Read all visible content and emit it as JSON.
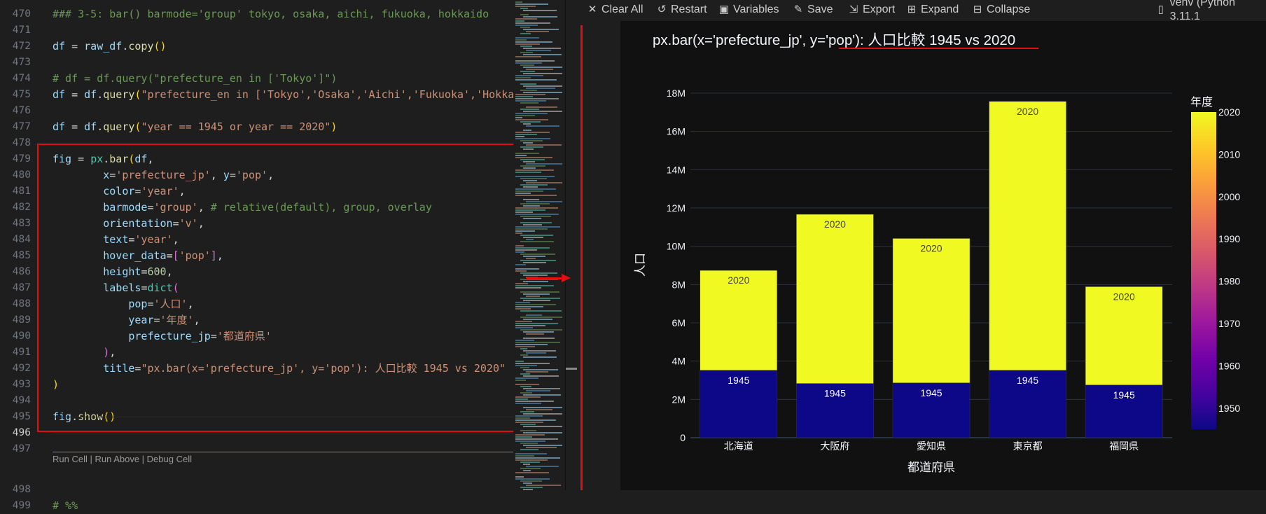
{
  "editor": {
    "lines": [
      {
        "n": "470",
        "tokens": [
          [
            "cm",
            "### 3-5: bar() barmode='group' tokyo, osaka, aichi, fukuoka, hokkaido"
          ]
        ]
      },
      {
        "n": "471",
        "tokens": []
      },
      {
        "n": "472",
        "tokens": [
          [
            "vr",
            "df"
          ],
          [
            "op",
            " = "
          ],
          [
            "vr",
            "raw_df"
          ],
          [
            "op",
            "."
          ],
          [
            "fn",
            "copy"
          ],
          [
            "py",
            "()"
          ]
        ]
      },
      {
        "n": "473",
        "tokens": []
      },
      {
        "n": "474",
        "tokens": [
          [
            "cm",
            "# df = df.query(\"prefecture_en in ['Tokyo']\")"
          ]
        ]
      },
      {
        "n": "475",
        "tokens": [
          [
            "vr",
            "df"
          ],
          [
            "op",
            " = "
          ],
          [
            "vr",
            "df"
          ],
          [
            "op",
            "."
          ],
          [
            "fn",
            "query"
          ],
          [
            "py",
            "("
          ],
          [
            "st",
            "\"prefecture_en in ['Tokyo','Osaka','Aichi','Fukuoka','Hokkaido']\""
          ],
          [
            "py",
            ")"
          ]
        ]
      },
      {
        "n": "476",
        "tokens": []
      },
      {
        "n": "477",
        "tokens": [
          [
            "vr",
            "df"
          ],
          [
            "op",
            " = "
          ],
          [
            "vr",
            "df"
          ],
          [
            "op",
            "."
          ],
          [
            "fn",
            "query"
          ],
          [
            "py",
            "("
          ],
          [
            "st",
            "\"year == 1945 or year == 2020\""
          ],
          [
            "py",
            ")"
          ]
        ]
      },
      {
        "n": "478",
        "tokens": []
      },
      {
        "n": "479",
        "tokens": [
          [
            "vr",
            "fig"
          ],
          [
            "op",
            " = "
          ],
          [
            "bi",
            "px"
          ],
          [
            "op",
            "."
          ],
          [
            "fn",
            "bar"
          ],
          [
            "py",
            "("
          ],
          [
            "vr",
            "df"
          ],
          [
            "op",
            ","
          ]
        ]
      },
      {
        "n": "480",
        "tokens": [
          [
            "op",
            "        "
          ],
          [
            "vr",
            "x"
          ],
          [
            "op",
            "="
          ],
          [
            "st",
            "'prefecture_jp'"
          ],
          [
            "op",
            ", "
          ],
          [
            "vr",
            "y"
          ],
          [
            "op",
            "="
          ],
          [
            "st",
            "'pop'"
          ],
          [
            "op",
            ","
          ]
        ]
      },
      {
        "n": "481",
        "tokens": [
          [
            "op",
            "        "
          ],
          [
            "vr",
            "color"
          ],
          [
            "op",
            "="
          ],
          [
            "st",
            "'year'"
          ],
          [
            "op",
            ","
          ]
        ]
      },
      {
        "n": "482",
        "tokens": [
          [
            "op",
            "        "
          ],
          [
            "vr",
            "barmode"
          ],
          [
            "op",
            "="
          ],
          [
            "st",
            "'group'"
          ],
          [
            "op",
            ", "
          ],
          [
            "cm",
            "# relative(default), group, overlay"
          ]
        ]
      },
      {
        "n": "483",
        "tokens": [
          [
            "op",
            "        "
          ],
          [
            "vr",
            "orientation"
          ],
          [
            "op",
            "="
          ],
          [
            "st",
            "'v'"
          ],
          [
            "op",
            ","
          ]
        ]
      },
      {
        "n": "484",
        "tokens": [
          [
            "op",
            "        "
          ],
          [
            "vr",
            "text"
          ],
          [
            "op",
            "="
          ],
          [
            "st",
            "'year'"
          ],
          [
            "op",
            ","
          ]
        ]
      },
      {
        "n": "485",
        "tokens": [
          [
            "op",
            "        "
          ],
          [
            "vr",
            "hover_data"
          ],
          [
            "op",
            "="
          ],
          [
            "pp",
            "["
          ],
          [
            "st",
            "'pop'"
          ],
          [
            "pp",
            "]"
          ],
          [
            "op",
            ","
          ]
        ]
      },
      {
        "n": "486",
        "tokens": [
          [
            "op",
            "        "
          ],
          [
            "vr",
            "height"
          ],
          [
            "op",
            "="
          ],
          [
            "nm",
            "600"
          ],
          [
            "op",
            ","
          ]
        ]
      },
      {
        "n": "487",
        "tokens": [
          [
            "op",
            "        "
          ],
          [
            "vr",
            "labels"
          ],
          [
            "op",
            "="
          ],
          [
            "bi",
            "dict"
          ],
          [
            "pp",
            "("
          ]
        ]
      },
      {
        "n": "488",
        "tokens": [
          [
            "op",
            "            "
          ],
          [
            "vr",
            "pop"
          ],
          [
            "op",
            "="
          ],
          [
            "st",
            "'人口'"
          ],
          [
            "op",
            ","
          ]
        ]
      },
      {
        "n": "489",
        "tokens": [
          [
            "op",
            "            "
          ],
          [
            "vr",
            "year"
          ],
          [
            "op",
            "="
          ],
          [
            "st",
            "'年度'"
          ],
          [
            "op",
            ","
          ]
        ]
      },
      {
        "n": "490",
        "tokens": [
          [
            "op",
            "            "
          ],
          [
            "vr",
            "prefecture_jp"
          ],
          [
            "op",
            "="
          ],
          [
            "st",
            "'都道府県'"
          ]
        ]
      },
      {
        "n": "491",
        "tokens": [
          [
            "op",
            "        "
          ],
          [
            "pp",
            ")"
          ],
          [
            "op",
            ","
          ]
        ]
      },
      {
        "n": "492",
        "tokens": [
          [
            "op",
            "        "
          ],
          [
            "vr",
            "title"
          ],
          [
            "op",
            "="
          ],
          [
            "st",
            "\"px.bar(x='prefecture_jp', y='pop'): 人口比較 1945 vs 2020\""
          ]
        ]
      },
      {
        "n": "493",
        "tokens": [
          [
            "py",
            ")"
          ]
        ]
      },
      {
        "n": "494",
        "tokens": []
      },
      {
        "n": "495",
        "tokens": [
          [
            "vr",
            "fig"
          ],
          [
            "op",
            "."
          ],
          [
            "fn",
            "show"
          ],
          [
            "py",
            "()"
          ]
        ]
      },
      {
        "n": "496",
        "tokens": [],
        "active": true
      },
      {
        "n": "497",
        "tokens": []
      }
    ],
    "codelens": "Run Cell | Run Above | Debug Cell",
    "line_498": {
      "n": "498",
      "text": "# %%"
    },
    "line_499": {
      "n": "499"
    }
  },
  "toolbar": {
    "items": [
      {
        "id": "clear-all",
        "label": "Clear All",
        "icon": "close-icon",
        "glyph": "✕"
      },
      {
        "id": "restart",
        "label": "Restart",
        "icon": "restart-icon",
        "glyph": "↺"
      },
      {
        "id": "variables",
        "label": "Variables",
        "icon": "variables-icon",
        "glyph": "▣"
      },
      {
        "id": "save",
        "label": "Save",
        "icon": "save-icon",
        "glyph": "✎"
      },
      {
        "id": "export",
        "label": "Export",
        "icon": "export-icon",
        "glyph": "⇲"
      },
      {
        "id": "expand",
        "label": "Expand",
        "icon": "expand-icon",
        "glyph": "⊞"
      },
      {
        "id": "collapse",
        "label": "Collapse",
        "icon": "collapse-icon",
        "glyph": "⊟"
      }
    ],
    "kernel": {
      "label": "venv (Python 3.11.1",
      "icon": "kernel-icon",
      "glyph": "▯"
    }
  },
  "chart_data": {
    "type": "bar",
    "barmode_rendered": "stacked",
    "title_prefix": "px.bar(x='prefecture_jp', y='pop'): ",
    "title_highlight": "人口比較 1945 vs 2020",
    "xlabel": "都道府県",
    "ylabel": "人口",
    "categories": [
      "北海道",
      "大阪府",
      "愛知県",
      "東京都",
      "福岡県"
    ],
    "series": [
      {
        "name": "1945",
        "color": "#0d0887",
        "text_color": "#ffffff",
        "values": [
          3520000,
          2830000,
          2860000,
          3520000,
          2750000
        ]
      },
      {
        "name": "2020",
        "color": "#f0f921",
        "text_color": "#444444",
        "values": [
          5220000,
          8840000,
          7550000,
          14050000,
          5140000
        ]
      }
    ],
    "ylim": [
      0,
      19000000
    ],
    "yticks": [
      0,
      2000000,
      4000000,
      6000000,
      8000000,
      10000000,
      12000000,
      14000000,
      16000000,
      18000000
    ],
    "ytick_labels": [
      "0",
      "2M",
      "4M",
      "6M",
      "8M",
      "10M",
      "12M",
      "14M",
      "16M",
      "18M"
    ],
    "grid": true,
    "colorbar": {
      "title": "年度",
      "range": [
        1945,
        2020
      ],
      "ticks": [
        1950,
        1960,
        1970,
        1980,
        1990,
        2000,
        2010,
        2020
      ],
      "colorscale": [
        "#0d0887",
        "#46039f",
        "#7201a8",
        "#9c179e",
        "#bd3786",
        "#d8576b",
        "#ed7953",
        "#fb9f3a",
        "#fdca26",
        "#f0f921"
      ],
      "placement": "right"
    }
  },
  "colors": {
    "annotation_red": "#e01010",
    "plot_bg": "#111111",
    "editor_bg": "#1e1e1e"
  }
}
